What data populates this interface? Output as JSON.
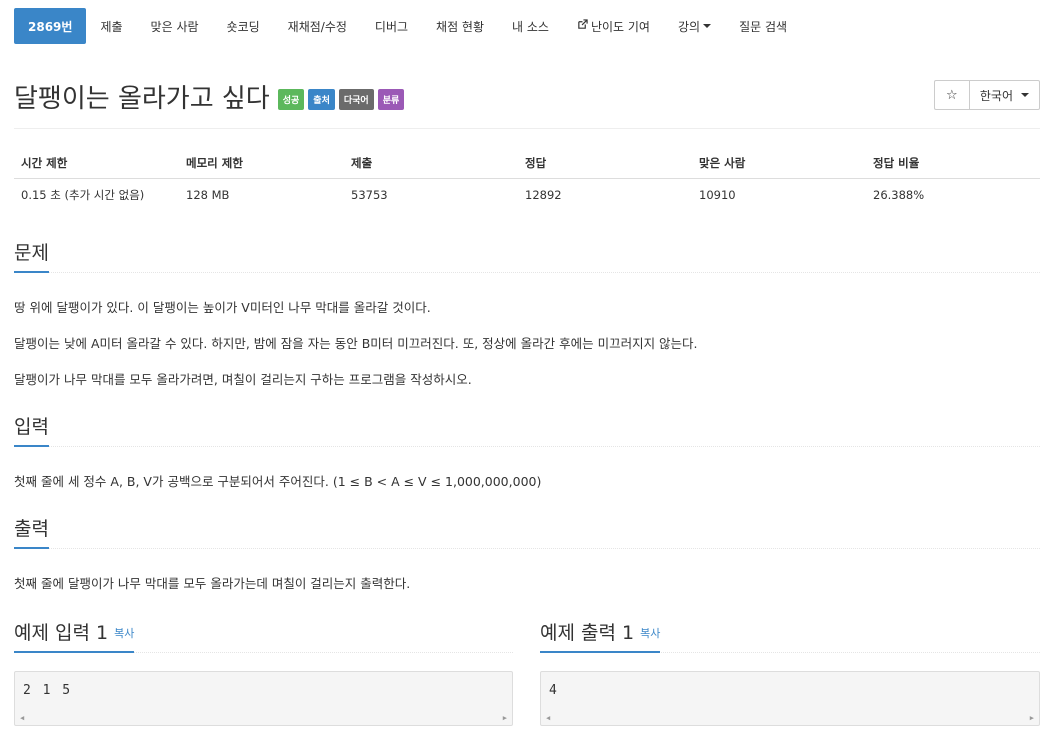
{
  "nav": {
    "items": [
      {
        "label": "2869번",
        "active": true
      },
      {
        "label": "제출"
      },
      {
        "label": "맞은 사람"
      },
      {
        "label": "숏코딩"
      },
      {
        "label": "재채점/수정"
      },
      {
        "label": "디버그"
      },
      {
        "label": "채점 현황"
      },
      {
        "label": "내 소스"
      },
      {
        "label": "난이도 기여",
        "icon": "external-link-icon"
      },
      {
        "label": "강의",
        "dropdown": true
      },
      {
        "label": "질문 검색"
      }
    ]
  },
  "problem": {
    "title": "달팽이는 올라가고 싶다",
    "badges": [
      "성공",
      "출처",
      "다국어",
      "분류"
    ]
  },
  "tools": {
    "star": "☆",
    "language": "한국어"
  },
  "stats": {
    "headers": [
      "시간 제한",
      "메모리 제한",
      "제출",
      "정답",
      "맞은 사람",
      "정답 비율"
    ],
    "values": [
      "0.15 초 (추가 시간 없음)",
      "128 MB",
      "53753",
      "12892",
      "10910",
      "26.388%"
    ]
  },
  "sections": {
    "description": {
      "heading": "문제",
      "paragraphs": [
        "땅 위에 달팽이가 있다. 이 달팽이는 높이가 V미터인 나무 막대를 올라갈 것이다.",
        "달팽이는 낮에 A미터 올라갈 수 있다. 하지만, 밤에 잠을 자는 동안 B미터 미끄러진다. 또, 정상에 올라간 후에는 미끄러지지 않는다.",
        "달팽이가 나무 막대를 모두 올라가려면, 며칠이 걸리는지 구하는 프로그램을 작성하시오."
      ]
    },
    "input": {
      "heading": "입력",
      "text": "첫째 줄에 세 정수 A, B, V가 공백으로 구분되어서 주어진다. (1 ≤ B < A ≤ V ≤ 1,000,000,000)"
    },
    "output": {
      "heading": "출력",
      "text": "첫째 줄에 달팽이가 나무 막대를 모두 올라가는데 며칠이 걸리는지 출력한다."
    },
    "sample_input": {
      "heading": "예제 입력 1",
      "copy": "복사",
      "content": "2 1 5"
    },
    "sample_output": {
      "heading": "예제 출력 1",
      "copy": "복사",
      "content": "4"
    }
  }
}
